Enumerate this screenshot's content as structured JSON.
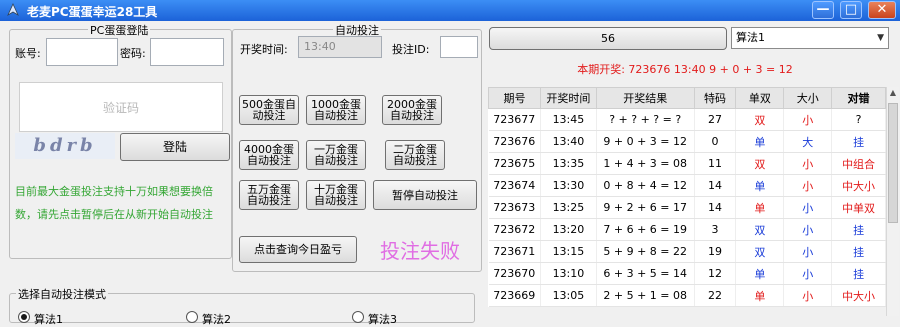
{
  "window": {
    "title": "老麦PC蛋蛋幸运28工具",
    "minimize": "—",
    "maximize": "□",
    "close": "✕"
  },
  "login": {
    "group_title": "PC蛋蛋登陆",
    "account_label": "账号:",
    "password_label": "密码:",
    "captcha_placeholder": "验证码",
    "captcha_image_text": "bdrb",
    "login_button": "登陆",
    "note": "目前最大金蛋投注支持十万如果想要换倍数，请先点击暂停后在从新开始自动投注"
  },
  "auto_bet": {
    "group_title": "自动投注",
    "open_time_label": "开奖时间:",
    "open_time_value": "13:40",
    "bet_id_label": "投注ID:",
    "buttons": [
      "500金蛋自动投注",
      "1000金蛋自动投注",
      "2000金蛋自动投注",
      "4000金蛋自动投注",
      "一万金蛋自动投注",
      "二万金蛋自动投注",
      "五万金蛋自动投注",
      "十万金蛋自动投注",
      "暂停自动投注"
    ],
    "query_button": "点击查询今日盈亏",
    "status": "投注失败"
  },
  "mode": {
    "group_title": "选择自动投注模式",
    "options": [
      "算法1",
      "算法2",
      "算法3"
    ]
  },
  "right": {
    "count_button": "56",
    "algorithm_select": "算法1",
    "current_draw": "本期开奖: 723676 13:40 9 + 0 + 3 = 12"
  },
  "table": {
    "headers": [
      "期号",
      "开奖时间",
      "开奖结果",
      "特码",
      "单双",
      "大小",
      "对错"
    ],
    "rows": [
      {
        "id": "723677",
        "time": "13:45",
        "result": "? + ? + ? = ?",
        "code": "27",
        "odd_even": "双",
        "odd_even_color": "#e21b1b",
        "size": "小",
        "size_color": "#e21b1b",
        "check": "?",
        "check_color": "#000000"
      },
      {
        "id": "723676",
        "time": "13:40",
        "result": "9 + 0 + 3 = 12",
        "code": "0",
        "odd_even": "单",
        "odd_even_color": "#1a3cd8",
        "size": "大",
        "size_color": "#1a3cd8",
        "check": "挂",
        "check_color": "#1a3cd8"
      },
      {
        "id": "723675",
        "time": "13:35",
        "result": "1 + 4 + 3 = 08",
        "code": "11",
        "odd_even": "双",
        "odd_even_color": "#e21b1b",
        "size": "小",
        "size_color": "#e21b1b",
        "check": "中组合",
        "check_color": "#e21b1b"
      },
      {
        "id": "723674",
        "time": "13:30",
        "result": "0 + 8 + 4 = 12",
        "code": "14",
        "odd_even": "单",
        "odd_even_color": "#1a3cd8",
        "size": "小",
        "size_color": "#e21b1b",
        "check": "中大小",
        "check_color": "#e21b1b"
      },
      {
        "id": "723673",
        "time": "13:25",
        "result": "9 + 2 + 6 = 17",
        "code": "14",
        "odd_even": "单",
        "odd_even_color": "#e21b1b",
        "size": "小",
        "size_color": "#1a3cd8",
        "check": "中单双",
        "check_color": "#e21b1b"
      },
      {
        "id": "723672",
        "time": "13:20",
        "result": "7 + 6 + 6 = 19",
        "code": "3",
        "odd_even": "双",
        "odd_even_color": "#1a3cd8",
        "size": "小",
        "size_color": "#1a3cd8",
        "check": "挂",
        "check_color": "#1a3cd8"
      },
      {
        "id": "723671",
        "time": "13:15",
        "result": "5 + 9 + 8 = 22",
        "code": "19",
        "odd_even": "双",
        "odd_even_color": "#1a3cd8",
        "size": "小",
        "size_color": "#1a3cd8",
        "check": "挂",
        "check_color": "#1a3cd8"
      },
      {
        "id": "723670",
        "time": "13:10",
        "result": "6 + 3 + 5 = 14",
        "code": "12",
        "odd_even": "单",
        "odd_even_color": "#1a3cd8",
        "size": "小",
        "size_color": "#1a3cd8",
        "check": "挂",
        "check_color": "#1a3cd8"
      },
      {
        "id": "723669",
        "time": "13:05",
        "result": "2 + 5 + 1 = 08",
        "code": "22",
        "odd_even": "单",
        "odd_even_color": "#e21b1b",
        "size": "小",
        "size_color": "#e21b1b",
        "check": "中大小",
        "check_color": "#e21b1b"
      }
    ]
  }
}
